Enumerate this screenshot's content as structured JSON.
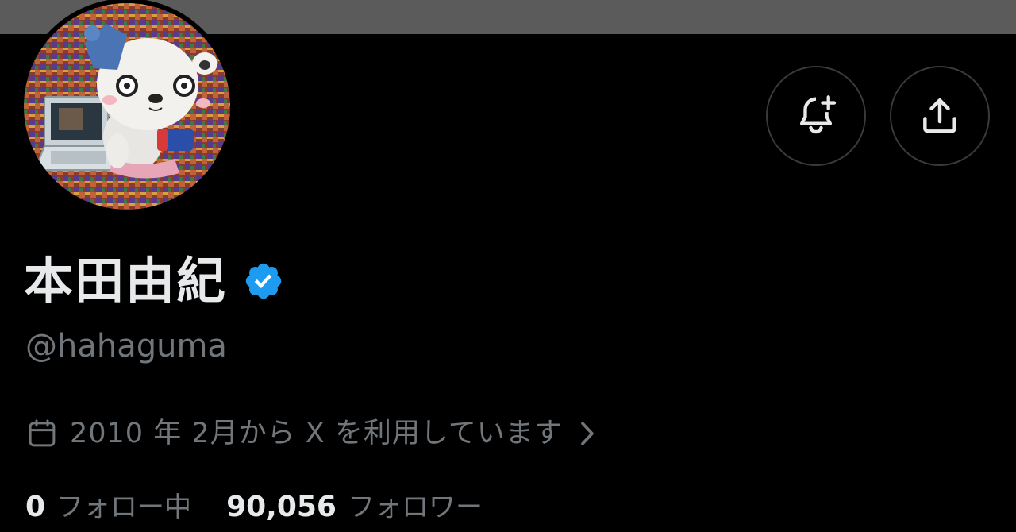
{
  "profile": {
    "display_name": "本田由紀",
    "handle": "@hahaguma",
    "joined": "2010 年 2月から X を利用しています",
    "avatar_alt": "avatar"
  },
  "actions": {
    "notify_icon": "bell-plus-icon",
    "share_icon": "share-upload-icon"
  },
  "icons": {
    "verified": "verified-badge-icon",
    "calendar": "calendar-icon",
    "chevron": "chevron-right-icon"
  },
  "stats": {
    "following_count": "0",
    "following_label": "フォロー中",
    "followers_count": "90,056",
    "followers_label": "フォロワー"
  },
  "colors": {
    "background": "#000000",
    "banner": "#5b5b5b",
    "primary_text": "#e7e9ea",
    "secondary_text": "#71767b",
    "verified_blue": "#1d9bf0",
    "button_border": "#3a3a3a"
  }
}
